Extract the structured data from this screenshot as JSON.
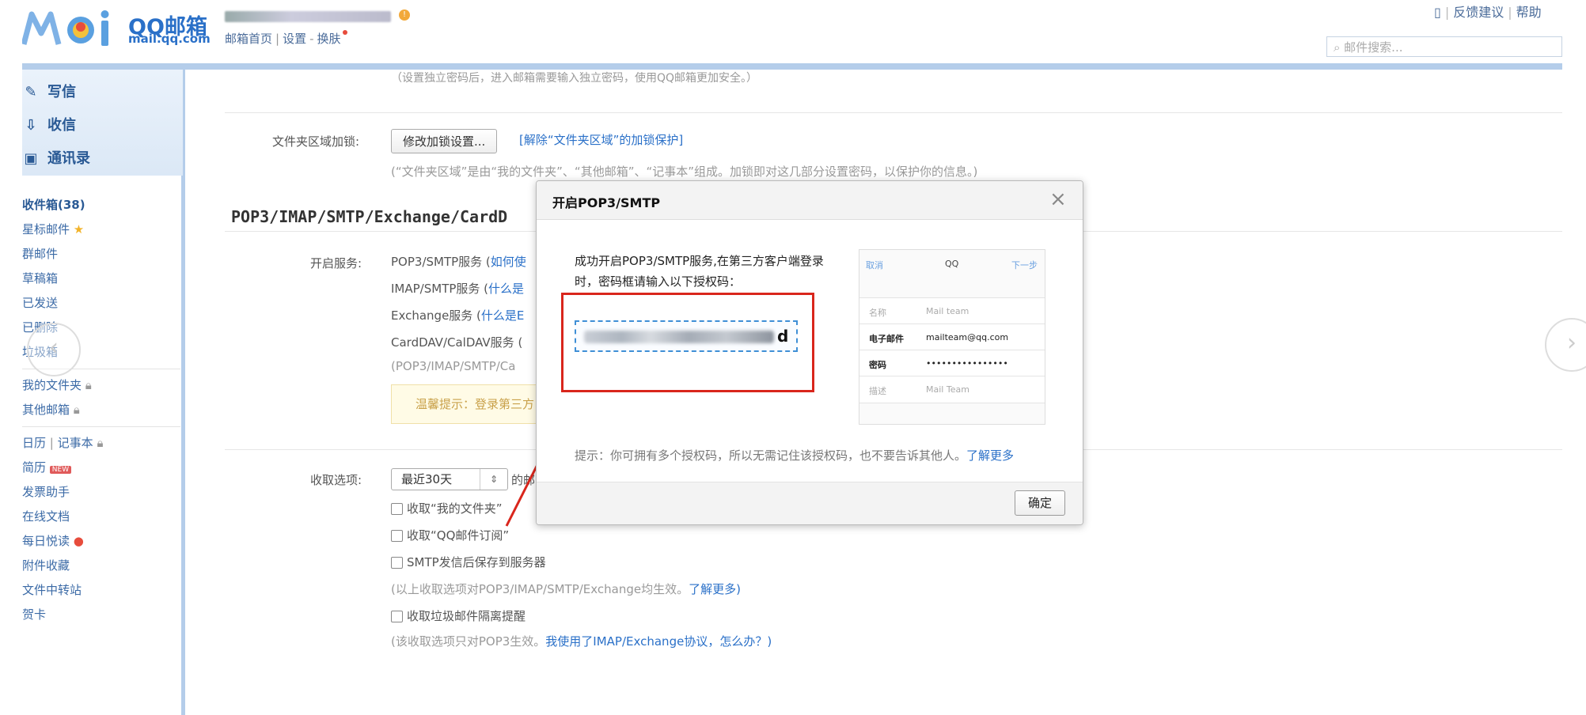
{
  "header": {
    "logo_qq": "QQ邮箱",
    "logo_sub": "mail.qq.com",
    "links": [
      "邮箱首页",
      "设置",
      "换肤"
    ],
    "top_right": [
      "反馈建议",
      "帮助"
    ],
    "search_placeholder": "邮件搜索..."
  },
  "sidebar": {
    "actions": [
      "写信",
      "收信",
      "通讯录"
    ],
    "items_group1": [
      "收件箱(38)",
      "星标邮件",
      "群邮件",
      "草稿箱",
      "已发送",
      "已删除",
      "垃圾箱"
    ],
    "items_group2": [
      "我的文件夹",
      "其他邮箱"
    ],
    "items_group3_calendar": "日历",
    "items_group3_note": "记事本",
    "items_group4": [
      "简历",
      "发票助手",
      "在线文档",
      "每日悦读",
      "附件收藏",
      "文件中转站",
      "贺卡"
    ],
    "new_badge": "NEW"
  },
  "main": {
    "top_note": "（设置独立密码后，进入邮箱需要输入独立密码，使用QQ邮箱更加安全。）",
    "folder_lock_label": "文件夹区域加锁:",
    "folder_lock_button": "修改加锁设置...",
    "folder_lock_link": "[解除“文件夹区域”的加锁保护]",
    "folder_lock_note": "(“文件夹区域”是由“我的文件夹”、“其他邮箱”、“记事本”组成。加锁即对这几部分设置密码，以保护你的信息。)",
    "section_title": "POP3/IMAP/SMTP/Exchange/CardD",
    "service_label": "开启服务:",
    "services": [
      {
        "name": "POP3/SMTP服务 (",
        "link": "如何使"
      },
      {
        "name": "IMAP/SMTP服务 (",
        "link": "什么是"
      },
      {
        "name": "Exchange服务 (",
        "link": "什么是E"
      },
      {
        "name": "CardDAV/CalDAV服务 (",
        "link": ""
      }
    ],
    "services_note": "(POP3/IMAP/SMTP/Ca",
    "tip": "温馨提示：登录第三方",
    "receive_label": "收取选项:",
    "receive_select": "最近30天",
    "receive_suffix": "的邮",
    "receive_checks": [
      "收取“我的文件夹”",
      "收取“QQ邮件订阅”",
      "SMTP发信后保存到服务器"
    ],
    "receive_note": "(以上收取选项对POP3/IMAP/SMTP/Exchange均生效。",
    "receive_note_link": "了解更多)",
    "spam_check": "收取垃圾邮件隔离提醒",
    "bottom_note": "(该收取选项只对POP3生效。",
    "bottom_note_link": "我使用了IMAP/Exchange协议，怎么办？)"
  },
  "dialog": {
    "title": "开启POP3/SMTP",
    "close": "×",
    "message": "成功开启POP3/SMTP服务,在第三方客户端登录时，密码框请输入以下授权码：",
    "code_visible_char": "d",
    "phone": {
      "cancel": "取消",
      "title": "QQ",
      "next": "下一步",
      "rows": [
        {
          "k": "名称",
          "v": "Mail team",
          "active": false
        },
        {
          "k": "电子邮件",
          "v": "mailteam@qq.com",
          "active": true
        },
        {
          "k": "密码",
          "v": "••••••••••••••••",
          "active": true
        },
        {
          "k": "描述",
          "v": "Mail Team",
          "active": false
        }
      ]
    },
    "hint": "提示：你可拥有多个授权码，所以无需记住该授权码，也不要告诉其他人。",
    "hint_link": "了解更多",
    "ok": "确定"
  }
}
